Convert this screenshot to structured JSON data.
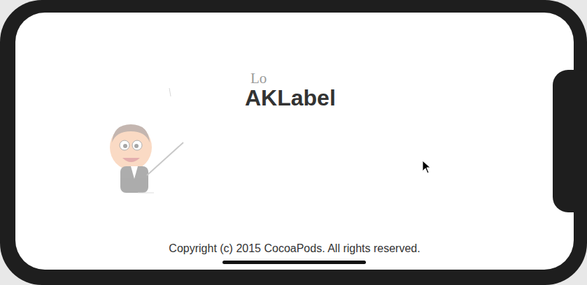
{
  "screen": {
    "animated_text": "Lo",
    "title": "AKLabel",
    "footer": "Copyright (c) 2015 CocoaPods. All rights reserved."
  }
}
